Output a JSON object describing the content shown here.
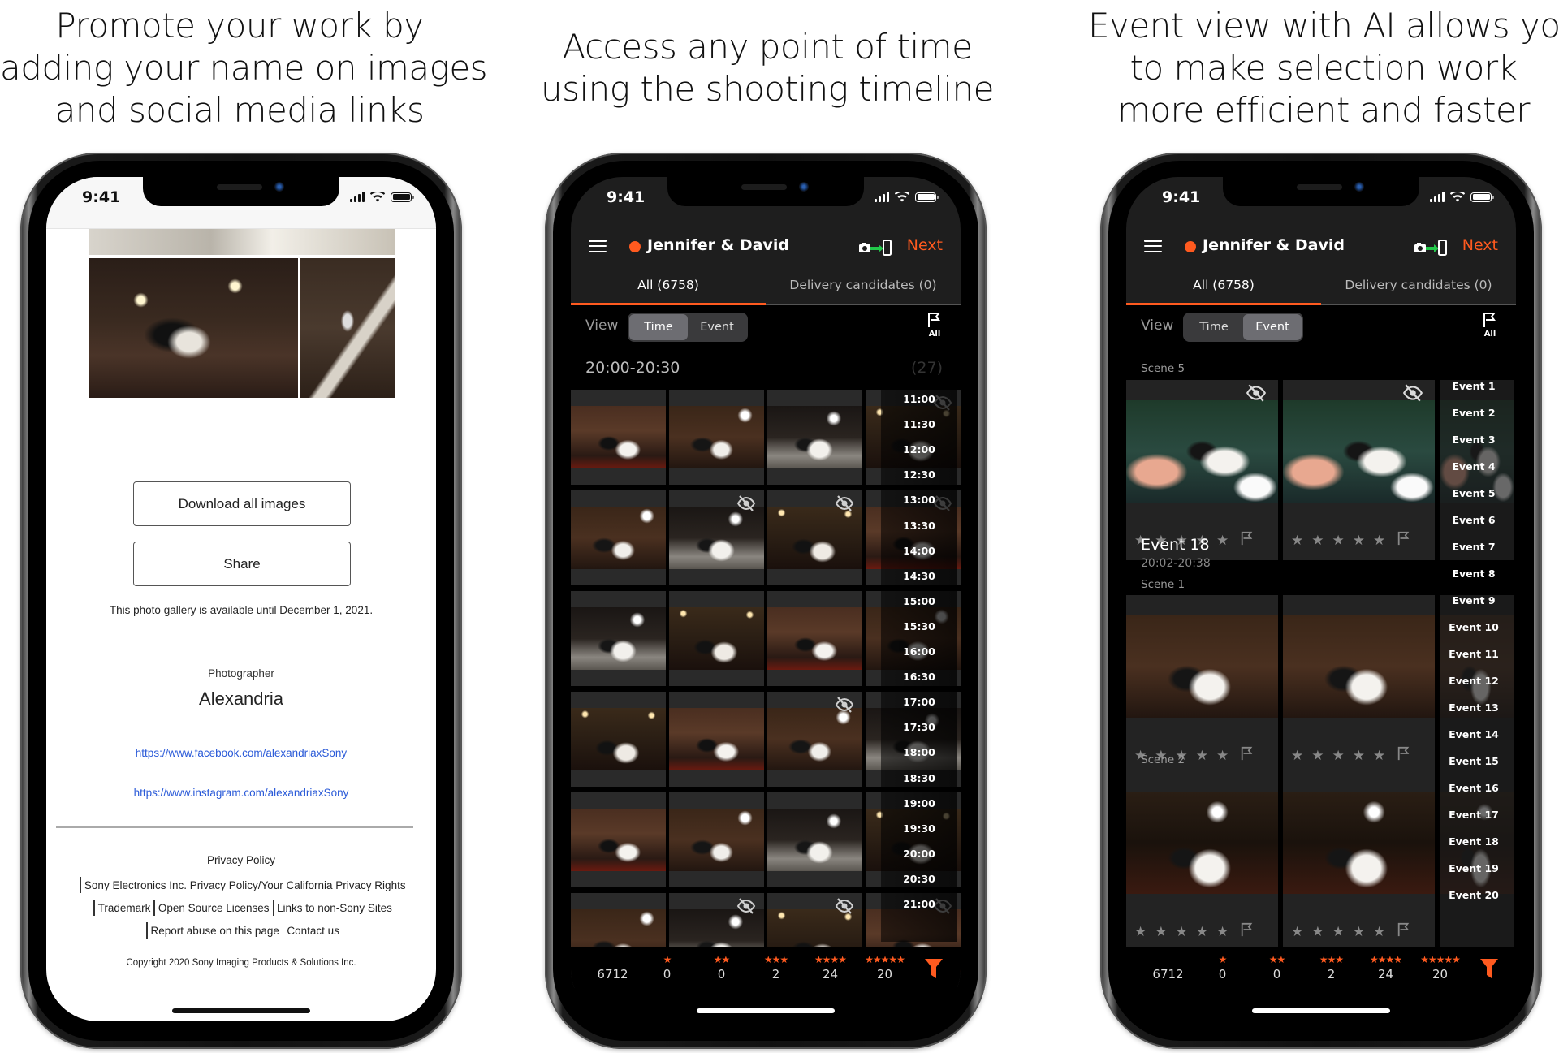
{
  "headlines": [
    {
      "lines": [
        "Promote your work by",
        "adding your name on images",
        "and social media links"
      ]
    },
    {
      "lines": [
        "Access any point of time",
        "using the shooting timeline"
      ]
    },
    {
      "lines": [
        "Event view with AI allows you",
        "to make selection work",
        "more efficient and faster"
      ]
    }
  ],
  "status_bar": {
    "time": "9:41"
  },
  "gallery_page": {
    "download_button": "Download all images",
    "share_button": "Share",
    "availability_note": "This photo gallery is available until December 1, 2021.",
    "photographer_label": "Photographer",
    "photographer_name": "Alexandria",
    "facebook_link": "https://www.facebook.com/alexandriaxSony",
    "instagram_link": "https://www.instagram.com/alexandriaxSony",
    "footer": {
      "privacy_policy": "Privacy Policy",
      "sony_privacy": "Sony Electronics Inc. Privacy Policy/Your California Privacy Rights",
      "trademark": "Trademark",
      "open_source": "Open Source Licenses",
      "non_sony": "Links to non-Sony Sites",
      "report_abuse": "Report abuse on this page",
      "contact": "Contact us",
      "copyright": "Copyright 2020 Sony Imaging Products & Solutions Inc."
    }
  },
  "app": {
    "project_title": "Jennifer & David",
    "next_label": "Next",
    "tabs": [
      {
        "label": "All (6758)",
        "active": true
      },
      {
        "label": "Delivery candidates (0)",
        "active": false
      }
    ],
    "view_label": "View",
    "view_options": [
      "Time",
      "Event"
    ],
    "flag_filter_label": "All",
    "accent_color": "#ff5a1f",
    "rating_summary": [
      {
        "stars": "-",
        "count": "6712"
      },
      {
        "stars": "★",
        "count": "0"
      },
      {
        "stars": "★★",
        "count": "0"
      },
      {
        "stars": "★★★",
        "count": "2"
      },
      {
        "stars": "★★★★",
        "count": "24"
      },
      {
        "stars": "★★★★★",
        "count": "20"
      }
    ]
  },
  "time_view": {
    "selected_view": "Time",
    "range": "20:00-20:30",
    "count": "(27)",
    "timeline_ticks": [
      "11:00",
      "11:30",
      "12:00",
      "12:30",
      "13:00",
      "13:30",
      "14:00",
      "14:30",
      "15:00",
      "15:30",
      "16:00",
      "16:30",
      "17:00",
      "17:30",
      "18:00",
      "18:30",
      "19:00",
      "19:30",
      "20:00",
      "20:30",
      "21:00"
    ],
    "rows": [
      {
        "hidden": [
          false,
          false,
          false,
          true
        ]
      },
      {
        "hidden": [
          false,
          true,
          true,
          true
        ]
      },
      {
        "hidden": [
          false,
          false,
          false,
          false
        ]
      },
      {
        "hidden": [
          false,
          false,
          true,
          false
        ]
      },
      {
        "hidden": [
          false,
          false,
          false,
          false
        ]
      },
      {
        "hidden": [
          false,
          true,
          true,
          true
        ]
      }
    ]
  },
  "event_view": {
    "selected_view": "Event",
    "sections": [
      {
        "scene": "Scene 5",
        "hidden": [
          true,
          true
        ]
      },
      {
        "event_title": "Event 18",
        "event_time": "20:02-20:38",
        "scene": "Scene 1",
        "hidden": [
          false,
          false
        ]
      },
      {
        "scene": "Scene 2",
        "hidden": [
          false,
          false
        ]
      }
    ],
    "event_index": [
      "Event 1",
      "Event 2",
      "Event 3",
      "Event 4",
      "Event 5",
      "Event 6",
      "Event 7",
      "Event 8",
      "Event 9",
      "Event 10",
      "Event 11",
      "Event 12",
      "Event 13",
      "Event 14",
      "Event 15",
      "Event 16",
      "Event 17",
      "Event 18",
      "Event 19",
      "Event 20"
    ]
  }
}
